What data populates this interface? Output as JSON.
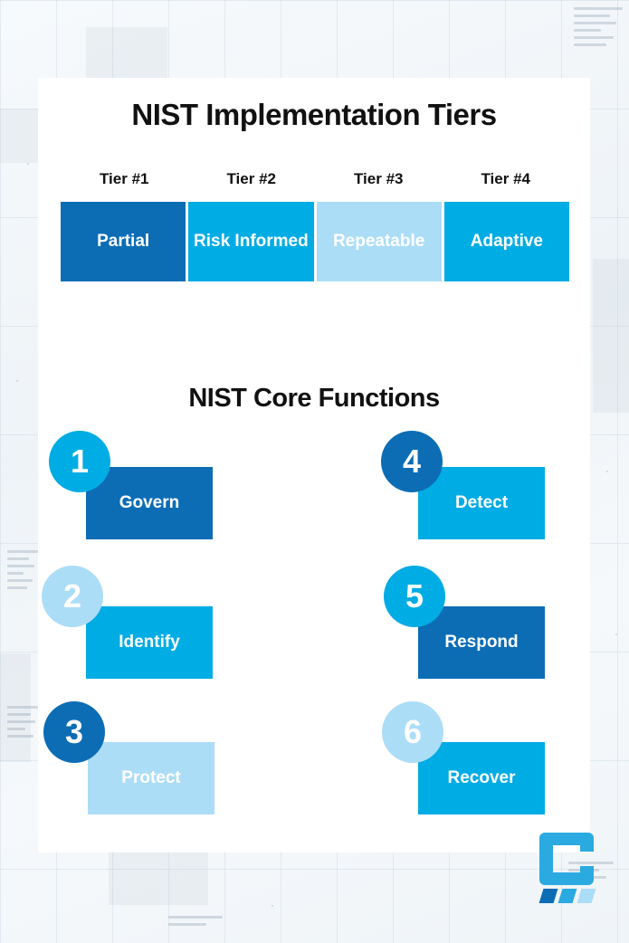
{
  "page": {
    "background_color": "#f2f6f9",
    "card_color": "#ffffff"
  },
  "palette": {
    "dark_blue": "#0C6DB5",
    "cyan": "#00ACE4",
    "light_blue": "#ACDDF7",
    "title_color": "#111111",
    "text_on_fill": "#ffffff"
  },
  "tiers_section": {
    "title": "NIST Implementation Tiers",
    "labels": [
      "Tier #1",
      "Tier #2",
      "Tier #3",
      "Tier #4"
    ],
    "segments": [
      {
        "name": "Partial",
        "color": "#0C6DB5"
      },
      {
        "name": "Risk Informed",
        "color": "#00ACE4"
      },
      {
        "name": "Repeatable",
        "color": "#ACDDF7"
      },
      {
        "name": "Adaptive",
        "color": "#00ACE4"
      }
    ]
  },
  "core_section": {
    "title": "NIST Core Functions",
    "functions": [
      {
        "number": "1",
        "label": "Govern",
        "circle_color": "#00ACE4",
        "box_color": "#0C6DB5"
      },
      {
        "number": "2",
        "label": "Identify",
        "circle_color": "#ACDDF7",
        "box_color": "#00ACE4"
      },
      {
        "number": "3",
        "label": "Protect",
        "circle_color": "#0C6DB5",
        "box_color": "#ACDDF7"
      },
      {
        "number": "4",
        "label": "Detect",
        "circle_color": "#0C6DB5",
        "box_color": "#00ACE4"
      },
      {
        "number": "5",
        "label": "Respond",
        "circle_color": "#00ACE4",
        "box_color": "#0C6DB5"
      },
      {
        "number": "6",
        "label": "Recover",
        "circle_color": "#ACDDF7",
        "box_color": "#00ACE4"
      }
    ]
  },
  "logo": {
    "mark": "letter-c",
    "c_color": "#2BAAE2",
    "bar_colors": [
      "#0C6DB5",
      "#2BAAE2",
      "#ACDDF7"
    ]
  }
}
